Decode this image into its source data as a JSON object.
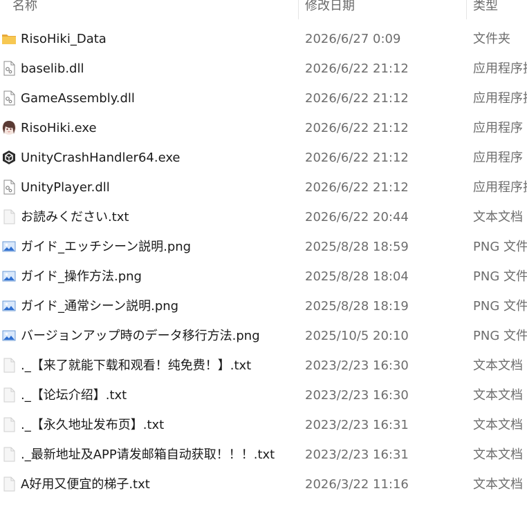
{
  "columns": {
    "name": "名称",
    "date": "修改日期",
    "type": "类型"
  },
  "files": [
    {
      "name": "RisoHiki_Data",
      "date": "2026/6/27 0:09",
      "type": "文件夹",
      "icon": "folder-icon"
    },
    {
      "name": "baselib.dll",
      "date": "2026/6/22 21:12",
      "type": "应用程序扩",
      "icon": "dll-file-icon"
    },
    {
      "name": "GameAssembly.dll",
      "date": "2026/6/22 21:12",
      "type": "应用程序扩",
      "icon": "dll-file-icon"
    },
    {
      "name": "RisoHiki.exe",
      "date": "2026/6/22 21:12",
      "type": "应用程序",
      "icon": "app-character-icon"
    },
    {
      "name": "UnityCrashHandler64.exe",
      "date": "2026/6/22 21:12",
      "type": "应用程序",
      "icon": "unity-icon"
    },
    {
      "name": "UnityPlayer.dll",
      "date": "2026/6/22 21:12",
      "type": "应用程序扩",
      "icon": "dll-file-icon"
    },
    {
      "name": "お読みください.txt",
      "date": "2026/6/22 20:44",
      "type": "文本文档",
      "icon": "text-file-icon"
    },
    {
      "name": "ガイド_エッチシーン説明.png",
      "date": "2025/8/28 18:59",
      "type": "PNG 文件",
      "icon": "image-file-icon"
    },
    {
      "name": "ガイド_操作方法.png",
      "date": "2025/8/28 18:04",
      "type": "PNG 文件",
      "icon": "image-file-icon"
    },
    {
      "name": "ガイド_通常シーン説明.png",
      "date": "2025/8/28 18:19",
      "type": "PNG 文件",
      "icon": "image-file-icon"
    },
    {
      "name": "バージョンアップ時のデータ移行方法.png",
      "date": "2025/10/5 20:10",
      "type": "PNG 文件",
      "icon": "image-file-icon"
    },
    {
      "name": "._【来了就能下载和观看！纯免费！】.txt",
      "date": "2023/2/23 16:30",
      "type": "文本文档",
      "icon": "text-file-icon"
    },
    {
      "name": "._【论坛介绍】.txt",
      "date": "2023/2/23 16:30",
      "type": "文本文档",
      "icon": "text-file-icon"
    },
    {
      "name": "._【永久地址发布页】.txt",
      "date": "2023/2/23 16:31",
      "type": "文本文档",
      "icon": "text-file-icon"
    },
    {
      "name": "._最新地址及APP请发邮箱自动获取！！！.txt",
      "date": "2023/2/23 16:31",
      "type": "文本文档",
      "icon": "text-file-icon"
    },
    {
      "name": "A好用又便宜的梯子.txt",
      "date": "2026/3/22 11:16",
      "type": "文本文档",
      "icon": "text-file-icon"
    }
  ]
}
